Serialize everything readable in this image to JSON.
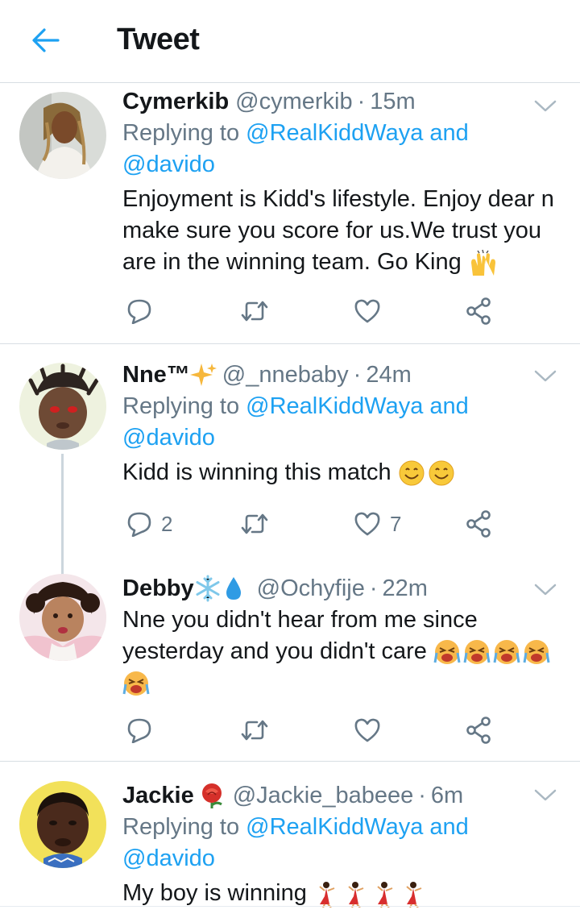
{
  "header": {
    "title": "Tweet"
  },
  "tweets": [
    {
      "name": "Cymerkib",
      "handle": "@cymerkib",
      "time": "15m",
      "replying_prefix": "Replying to ",
      "replying_first": "@RealKiddWaya",
      "replying_and": " and",
      "replying_second": "@davido",
      "text_lines": [
        "Enjoyment is Kidd's lifestyle. Enjoy dear n",
        "make sure you score for us.We trust you",
        "are in the winning team. Go King"
      ],
      "reply_count": "",
      "retweet_count": "",
      "like_count": ""
    },
    {
      "name": "Nne™",
      "handle": "@_nnebaby",
      "time": "24m",
      "replying_prefix": "Replying to ",
      "replying_first": "@RealKiddWaya",
      "replying_and": " and",
      "replying_second": "@davido",
      "text_lines": [
        "Kidd is winning this match"
      ],
      "reply_count": "2",
      "retweet_count": "",
      "like_count": "7"
    },
    {
      "name": "Debby",
      "handle": "@Ochyfije",
      "time": "22m",
      "text_lines": [
        "Nne you didn't hear from me since",
        "yesterday and you didn't care"
      ],
      "reply_count": "",
      "retweet_count": "",
      "like_count": ""
    },
    {
      "name": "Jackie",
      "handle": "@Jackie_babeee",
      "time": "6m",
      "replying_prefix": "Replying to ",
      "replying_first": "@RealKiddWaya",
      "replying_and": " and",
      "replying_second": "@davido",
      "text_lines": [
        "My boy is winning"
      ]
    }
  ],
  "separator": "·",
  "colors": {
    "accent": "#1da1f2",
    "secondary_text": "#657786",
    "divider": "#d8dee3",
    "icon": "#657786"
  },
  "icons": [
    "back-arrow-icon",
    "caret-down-icon",
    "reply-icon",
    "retweet-icon",
    "like-icon",
    "share-icon",
    "sparkles-emoji",
    "snowflake-emoji",
    "droplet-emoji",
    "rose-emoji",
    "raising-hands-emoji",
    "smiling-face-emoji",
    "crying-face-emoji",
    "dancer-emoji"
  ]
}
